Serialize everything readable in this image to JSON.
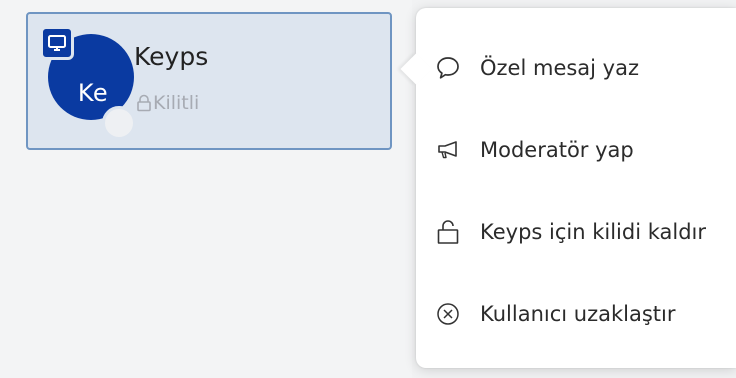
{
  "user": {
    "name": "Keyps",
    "initials": "Ke",
    "status": "Kilitli",
    "avatar_color": "#0a3aa1"
  },
  "menu": {
    "items": [
      {
        "label": "Özel mesaj yaz",
        "icon": "speech-bubble-icon"
      },
      {
        "label": "Moderatör yap",
        "icon": "megaphone-icon"
      },
      {
        "label": "Keyps için kilidi kaldır",
        "icon": "unlock-icon"
      },
      {
        "label": "Kullanıcı uzaklaştır",
        "icon": "circle-x-icon"
      }
    ]
  },
  "colors": {
    "card_background": "#dde5ef",
    "card_border": "#6f95c2",
    "menu_background": "#ffffff"
  }
}
